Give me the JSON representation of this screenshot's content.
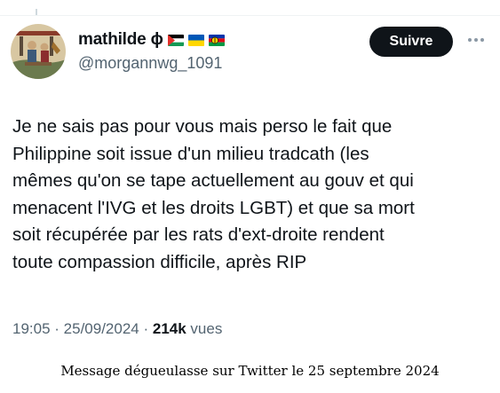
{
  "tweet": {
    "display_name": "mathilde ɸ",
    "handle": "@morgannwg_1091",
    "flags": [
      "palestine-flag-icon",
      "ukraine-flag-icon",
      "kanaky-flag-icon"
    ],
    "follow_label": "Suivre",
    "text_lines": [
      "Je ne sais pas pour vous mais perso le fait que",
      "Philippine soit issue d'un milieu tradcath (les",
      "mêmes qu'on se tape actuellement au gouv et qui",
      "menacent l'IVG et les droits LGBT) et que sa mort",
      "soit récupérée par les rats d'ext-droite rendent",
      "toute compassion difficile, après RIP"
    ],
    "time": "19:05",
    "date": "25/09/2024",
    "separator": " · ",
    "views_count": "214k",
    "views_label": " vues"
  },
  "caption": "Message dégueulasse sur Twitter le 25 septembre 2024",
  "colors": {
    "text": "#0f1419",
    "secondary": "#536471",
    "button_bg": "#0f1419",
    "button_text": "#ffffff"
  }
}
